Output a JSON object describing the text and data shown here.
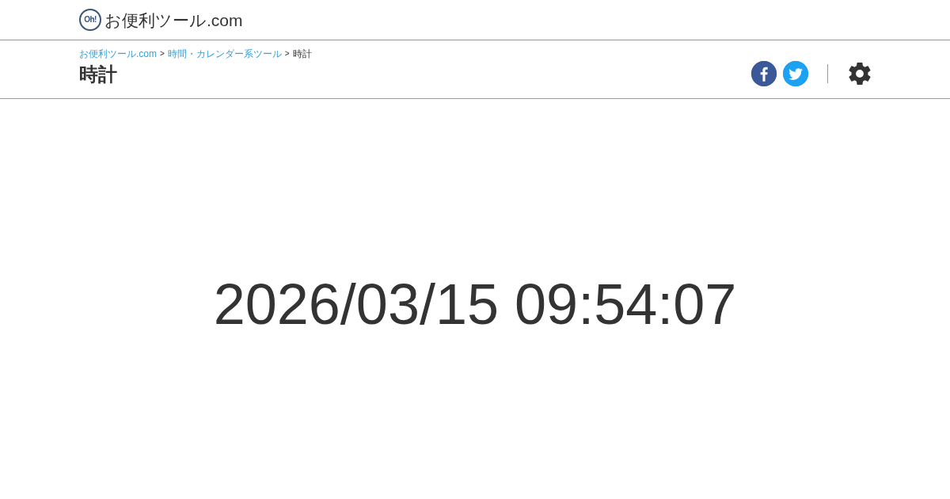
{
  "header": {
    "logo_mark": "Oh!",
    "site_name": "お便利ツール.com"
  },
  "breadcrumb": [
    {
      "label": "お便利ツール.com",
      "kind": "link"
    },
    {
      "label": ">",
      "kind": "separator"
    },
    {
      "label": "時間・カレンダー系ツール",
      "kind": "link"
    },
    {
      "label": ">",
      "kind": "separator"
    },
    {
      "label": "時計",
      "kind": "current"
    }
  ],
  "page_title": "時計",
  "share_buttons": [
    {
      "kind": "facebook",
      "color": "#3b5998"
    },
    {
      "kind": "twitter",
      "color": "#1da1f2"
    }
  ],
  "clock": {
    "display": "2026/03/15 09:54:07"
  }
}
